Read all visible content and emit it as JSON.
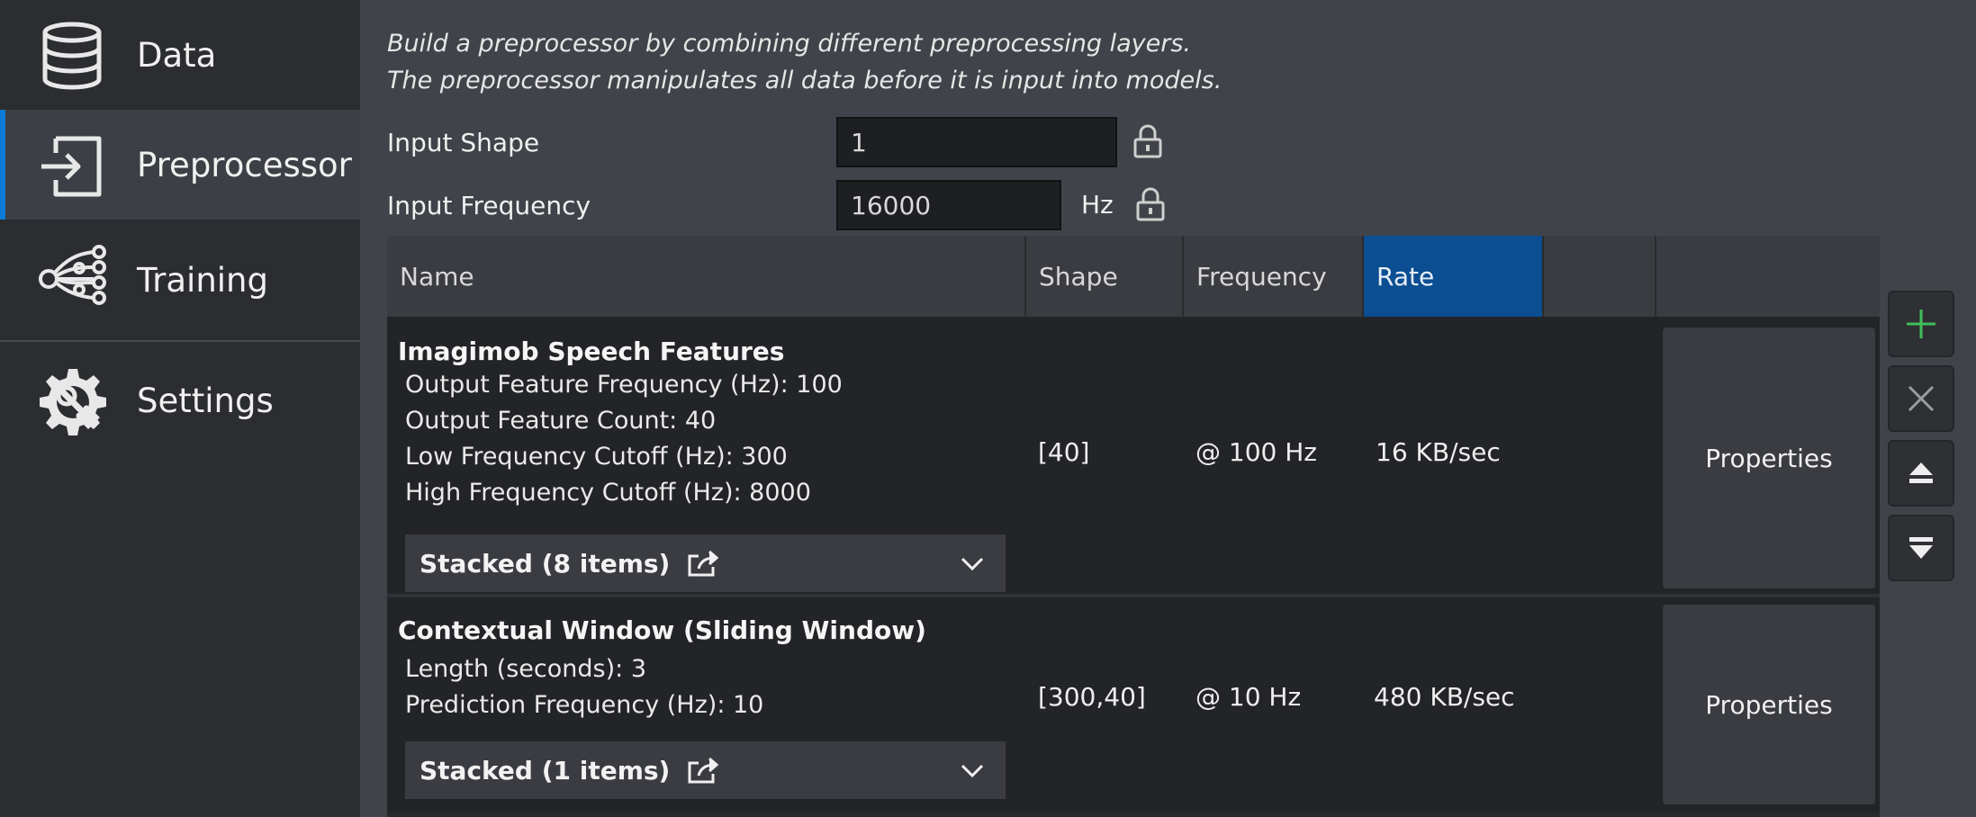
{
  "sidebar": {
    "items": [
      {
        "label": "Data",
        "icon": "database-icon"
      },
      {
        "label": "Preprocessor",
        "icon": "sign-in-icon"
      },
      {
        "label": "Training",
        "icon": "network-icon"
      },
      {
        "label": "Settings",
        "icon": "gear-wrench-icon"
      }
    ],
    "active": "Preprocessor"
  },
  "main": {
    "description": [
      "Build a preprocessor by combining different preprocessing layers.",
      "The preprocessor manipulates all data before it is input into models."
    ],
    "input_shape": {
      "label": "Input Shape",
      "value": "1"
    },
    "input_frequency": {
      "label": "Input Frequency",
      "value": "16000",
      "unit": "Hz"
    }
  },
  "table": {
    "columns": [
      "Name",
      "Shape",
      "Frequency",
      "Rate",
      "",
      ""
    ],
    "selected_column": "Rate",
    "rows": [
      {
        "title": "Imagimob Speech Features",
        "params": [
          "Output Feature Frequency (Hz): 100",
          "Output Feature Count: 40",
          "Low Frequency Cutoff (Hz): 300",
          "High Frequency Cutoff (Hz): 8000"
        ],
        "stacked": "Stacked (8 items)",
        "shape": "[40]",
        "frequency": "@ 100 Hz",
        "rate": "16 KB/sec",
        "button": "Properties"
      },
      {
        "title": "Contextual Window (Sliding Window)",
        "params": [
          "Length (seconds): 3",
          "Prediction Frequency (Hz): 10"
        ],
        "stacked": "Stacked (1 items)",
        "shape": "[300,40]",
        "frequency": "@ 10 Hz",
        "rate": "480 KB/sec",
        "button": "Properties"
      }
    ]
  },
  "side_buttons": [
    "plus-icon",
    "close-icon",
    "move-up-icon",
    "move-down-icon"
  ],
  "colors": {
    "accent": "#0a7bd6",
    "selected_header": "#0b4e92",
    "plus": "#3fbf5a"
  }
}
